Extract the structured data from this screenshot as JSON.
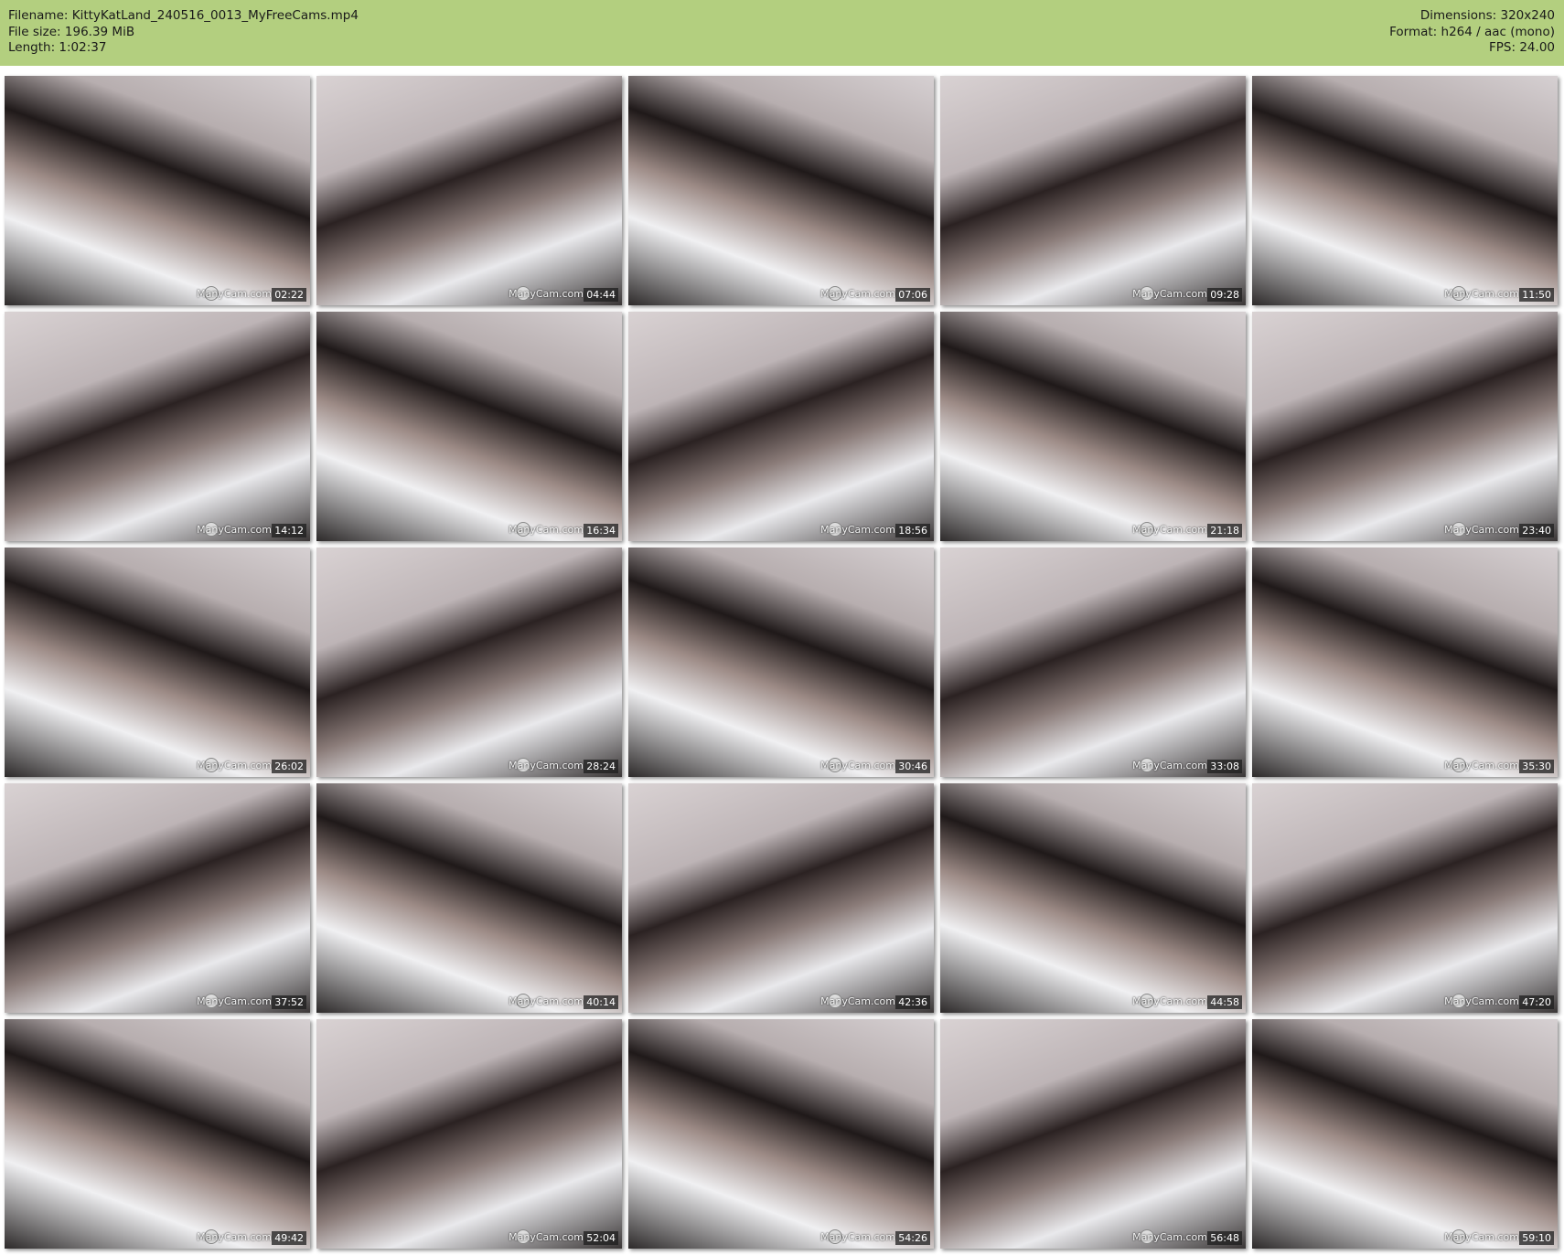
{
  "header": {
    "filename": "Filename: KittyKatLand_240516_0013_MyFreeCams.mp4",
    "filesize": "File size: 196.39 MiB",
    "length": "Length: 1:02:37",
    "dimensions": "Dimensions: 320x240",
    "format": "Format: h264 / aac (mono)",
    "fps": "FPS: 24.00"
  },
  "watermark": "ManyCam.com",
  "thumbnails": [
    {
      "time": "02:22"
    },
    {
      "time": "04:44"
    },
    {
      "time": "07:06"
    },
    {
      "time": "09:28"
    },
    {
      "time": "11:50"
    },
    {
      "time": "14:12"
    },
    {
      "time": "16:34"
    },
    {
      "time": "18:56"
    },
    {
      "time": "21:18"
    },
    {
      "time": "23:40"
    },
    {
      "time": "26:02"
    },
    {
      "time": "28:24"
    },
    {
      "time": "30:46"
    },
    {
      "time": "33:08"
    },
    {
      "time": "35:30"
    },
    {
      "time": "37:52"
    },
    {
      "time": "40:14"
    },
    {
      "time": "42:36"
    },
    {
      "time": "44:58"
    },
    {
      "time": "47:20"
    },
    {
      "time": "49:42"
    },
    {
      "time": "52:04"
    },
    {
      "time": "54:26"
    },
    {
      "time": "56:48"
    },
    {
      "time": "59:10"
    }
  ]
}
